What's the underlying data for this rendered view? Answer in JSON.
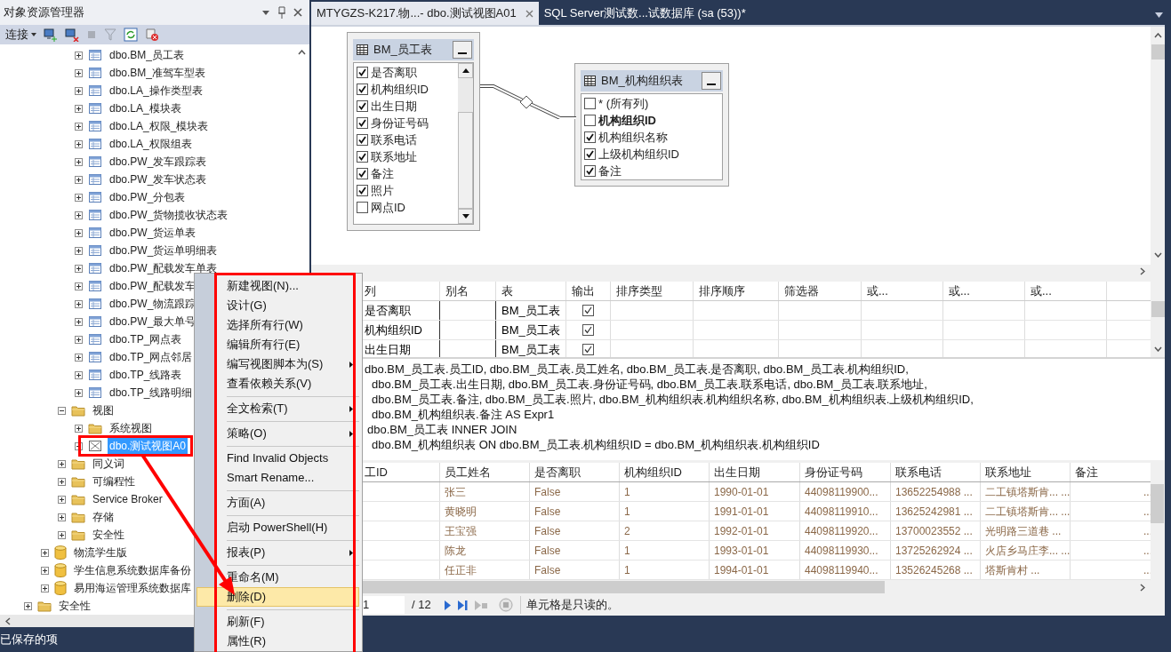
{
  "explorer": {
    "title": "对象资源管理器",
    "connect_label": "连接",
    "tree": {
      "tables": [
        {
          "kind": "table",
          "label": "dbo.BM_员工表",
          "expanded": false,
          "selected": false
        },
        {
          "kind": "table",
          "label": "dbo.BM_准驾车型表",
          "expanded": false,
          "selected": false
        },
        {
          "kind": "table",
          "label": "dbo.LA_操作类型表",
          "expanded": false,
          "selected": false
        },
        {
          "kind": "table",
          "label": "dbo.LA_模块表",
          "expanded": false,
          "selected": false
        },
        {
          "kind": "table",
          "label": "dbo.LA_权限_模块表",
          "expanded": false,
          "selected": false
        },
        {
          "kind": "table",
          "label": "dbo.LA_权限组表",
          "expanded": false,
          "selected": false
        },
        {
          "kind": "table",
          "label": "dbo.PW_发车跟踪表",
          "expanded": false,
          "selected": false
        },
        {
          "kind": "table",
          "label": "dbo.PW_发车状态表",
          "expanded": false,
          "selected": false
        },
        {
          "kind": "table",
          "label": "dbo.PW_分包表",
          "expanded": false,
          "selected": false
        },
        {
          "kind": "table",
          "label": "dbo.PW_货物揽收状态表",
          "expanded": false,
          "selected": false
        },
        {
          "kind": "table",
          "label": "dbo.PW_货运单表",
          "expanded": false,
          "selected": false
        },
        {
          "kind": "table",
          "label": "dbo.PW_货运单明细表",
          "expanded": false,
          "selected": false
        },
        {
          "kind": "table",
          "label": "dbo.PW_配载发车单表",
          "expanded": false,
          "selected": false
        },
        {
          "kind": "table",
          "label": "dbo.PW_配载发车",
          "expanded": false,
          "selected": false
        },
        {
          "kind": "table",
          "label": "dbo.PW_物流跟踪",
          "expanded": false,
          "selected": false
        },
        {
          "kind": "table",
          "label": "dbo.PW_最大单号",
          "expanded": false,
          "selected": false
        },
        {
          "kind": "table",
          "label": "dbo.TP_网点表",
          "expanded": false,
          "selected": false
        },
        {
          "kind": "table",
          "label": "dbo.TP_网点邻居",
          "expanded": false,
          "selected": false
        },
        {
          "kind": "table",
          "label": "dbo.TP_线路表",
          "expanded": false,
          "selected": false
        },
        {
          "kind": "table",
          "label": "dbo.TP_线路明细",
          "expanded": false,
          "selected": false
        }
      ],
      "db_folders": [
        {
          "kind": "folder",
          "label": "视图",
          "expanded": true,
          "selected": false,
          "children": [
            {
              "kind": "folder",
              "label": "系统视图",
              "expanded": false,
              "selected": false
            },
            {
              "kind": "view",
              "label": "dbo.测试视图A0",
              "expanded": false,
              "selected": true
            }
          ]
        },
        {
          "kind": "folder",
          "label": "同义词",
          "expanded": false,
          "selected": false
        },
        {
          "kind": "folder",
          "label": "可编程性",
          "expanded": false,
          "selected": false
        },
        {
          "kind": "folder",
          "label": "Service Broker",
          "expanded": false,
          "selected": false
        },
        {
          "kind": "folder",
          "label": "存储",
          "expanded": false,
          "selected": false
        },
        {
          "kind": "folder",
          "label": "安全性",
          "expanded": false,
          "selected": false
        }
      ],
      "databases": [
        {
          "kind": "database",
          "label": "物流学生版",
          "expanded": false,
          "selected": false
        },
        {
          "kind": "database",
          "label": "学生信息系统数据库备份",
          "expanded": false,
          "selected": false
        },
        {
          "kind": "database",
          "label": "易用海运管理系统数据库",
          "expanded": false,
          "selected": false
        }
      ],
      "server_folders": [
        {
          "kind": "folder",
          "label": "安全性",
          "expanded": false,
          "selected": false
        }
      ]
    }
  },
  "context_menu": [
    {
      "kind": "item",
      "label": "新建视图(N)...",
      "submenu": false,
      "selected": false
    },
    {
      "kind": "item",
      "label": "设计(G)",
      "submenu": false,
      "selected": false
    },
    {
      "kind": "item",
      "label": "选择所有行(W)",
      "submenu": false,
      "selected": false
    },
    {
      "kind": "item",
      "label": "编辑所有行(E)",
      "submenu": false,
      "selected": false
    },
    {
      "kind": "item",
      "label": "编写视图脚本为(S)",
      "submenu": true,
      "selected": false
    },
    {
      "kind": "item",
      "label": "查看依赖关系(V)",
      "submenu": false,
      "selected": false
    },
    {
      "kind": "separator"
    },
    {
      "kind": "item",
      "label": "全文检索(T)",
      "submenu": true,
      "selected": false
    },
    {
      "kind": "separator"
    },
    {
      "kind": "item",
      "label": "策略(O)",
      "submenu": true,
      "selected": false
    },
    {
      "kind": "separator"
    },
    {
      "kind": "item",
      "label": "Find Invalid Objects",
      "submenu": false,
      "selected": false
    },
    {
      "kind": "item",
      "label": "Smart Rename...",
      "submenu": false,
      "selected": false
    },
    {
      "kind": "separator"
    },
    {
      "kind": "item",
      "label": "方面(A)",
      "submenu": false,
      "selected": false
    },
    {
      "kind": "separator"
    },
    {
      "kind": "item",
      "label": "启动 PowerShell(H)",
      "submenu": false,
      "selected": false
    },
    {
      "kind": "separator"
    },
    {
      "kind": "item",
      "label": "报表(P)",
      "submenu": true,
      "selected": false
    },
    {
      "kind": "separator"
    },
    {
      "kind": "item",
      "label": "重命名(M)",
      "submenu": false,
      "selected": false
    },
    {
      "kind": "item",
      "label": "删除(D)",
      "submenu": false,
      "selected": true
    },
    {
      "kind": "separator"
    },
    {
      "kind": "item",
      "label": "刷新(F)",
      "submenu": false,
      "selected": false
    },
    {
      "kind": "item",
      "label": "属性(R)",
      "submenu": false,
      "selected": false
    }
  ],
  "tabs": [
    {
      "label": "MTYGZS-K217.物...- dbo.测试视图A01",
      "selected": true,
      "closable": true
    },
    {
      "label": "SQL Server测试数...试数据库 (sa (53))*",
      "selected": false,
      "closable": false
    }
  ],
  "diagram": {
    "tables": [
      {
        "title": "BM_员工表",
        "columns": [
          {
            "label": "是否离职",
            "checked": true,
            "key": false
          },
          {
            "label": "机构组织ID",
            "checked": true,
            "key": false
          },
          {
            "label": "出生日期",
            "checked": true,
            "key": false
          },
          {
            "label": "身份证号码",
            "checked": true,
            "key": false
          },
          {
            "label": "联系电话",
            "checked": true,
            "key": false
          },
          {
            "label": "联系地址",
            "checked": true,
            "key": false
          },
          {
            "label": "备注",
            "checked": true,
            "key": false
          },
          {
            "label": "照片",
            "checked": true,
            "key": false
          },
          {
            "label": "网点ID",
            "checked": false,
            "key": false
          }
        ]
      },
      {
        "title": "BM_机构组织表",
        "columns": [
          {
            "label": "* (所有列)",
            "checked": false,
            "key": false
          },
          {
            "label": "机构组织ID",
            "checked": false,
            "key": true
          },
          {
            "label": "机构组织名称",
            "checked": true,
            "key": false
          },
          {
            "label": "上级机构组织ID",
            "checked": true,
            "key": false
          },
          {
            "label": "备注",
            "checked": true,
            "key": false
          }
        ]
      }
    ]
  },
  "criteria": {
    "columns": [
      "列",
      "别名",
      "表",
      "输出",
      "排序类型",
      "排序顺序",
      "筛选器",
      "或...",
      "或...",
      "或..."
    ],
    "rows": [
      {
        "column": "是否离职",
        "table": "BM_员工表",
        "output": true
      },
      {
        "column": "机构组织ID",
        "table": "BM_员工表",
        "output": true
      },
      {
        "column": "出生日期",
        "table": "BM_员工表",
        "output": true
      }
    ]
  },
  "sql_lines": [
    "dbo.BM_员工表.员工ID, dbo.BM_员工表.员工姓名, dbo.BM_员工表.是否离职, dbo.BM_员工表.机构组织ID,",
    "dbo.BM_员工表.出生日期, dbo.BM_员工表.身份证号码, dbo.BM_员工表.联系电话, dbo.BM_员工表.联系地址,",
    "dbo.BM_员工表.备注, dbo.BM_员工表.照片, dbo.BM_机构组织表.机构组织名称, dbo.BM_机构组织表.上级机构组织ID,",
    "dbo.BM_机构组织表.备注 AS Expr1",
    "dbo.BM_员工表 INNER JOIN",
    "dbo.BM_机构组织表 ON dbo.BM_员工表.机构组织ID = dbo.BM_机构组织表.机构组织ID"
  ],
  "results": {
    "columns": [
      "工ID",
      "员工姓名",
      "是否离职",
      "机构组织ID",
      "出生日期",
      "身份证号码",
      "联系电话",
      "联系地址",
      "备注"
    ],
    "rows": [
      [
        "",
        "张三",
        "False",
        "1",
        "1990-01-01",
        "44098119900...",
        "13652254988 ...",
        "二工镇塔斯肯... ...",
        "..."
      ],
      [
        "",
        "黄晓明",
        "False",
        "1",
        "1991-01-01",
        "44098119910...",
        "13625242981 ...",
        "二工镇塔斯肯... ...",
        "..."
      ],
      [
        "",
        "王宝强",
        "False",
        "2",
        "1992-01-01",
        "44098119920...",
        "13700023552 ...",
        "光明路三道巷 ...",
        "..."
      ],
      [
        "",
        "陈龙",
        "False",
        "1",
        "1993-01-01",
        "44098119930...",
        "13725262924 ...",
        "火店乡马庄李... ...",
        "..."
      ],
      [
        "",
        "任正非",
        "False",
        "1",
        "1994-01-01",
        "44098119940...",
        "13526245268 ...",
        "塔斯肯村 ...",
        "..."
      ]
    ]
  },
  "navigator": {
    "record": "1",
    "total": "/ 12",
    "message": "单元格是只读的。"
  },
  "status_bar": "已保存的项"
}
